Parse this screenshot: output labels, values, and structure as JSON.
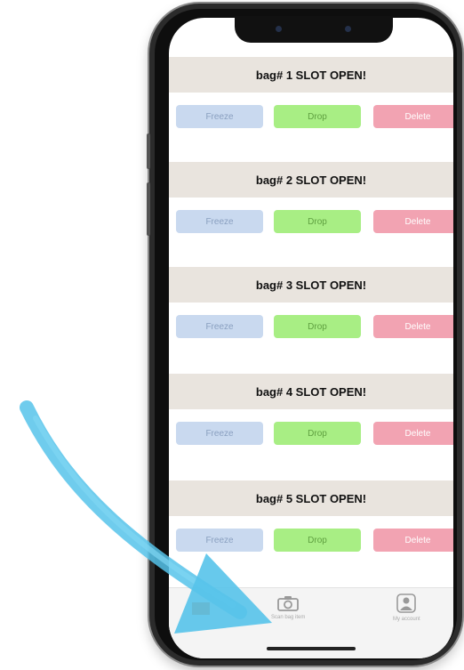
{
  "slots": [
    {
      "title": "bag# 1  SLOT OPEN!",
      "freeze": "Freeze",
      "drop": "Drop",
      "delete": "Delete"
    },
    {
      "title": "bag# 2  SLOT OPEN!",
      "freeze": "Freeze",
      "drop": "Drop",
      "delete": "Delete"
    },
    {
      "title": "bag# 3  SLOT OPEN!",
      "freeze": "Freeze",
      "drop": "Drop",
      "delete": "Delete"
    },
    {
      "title": "bag# 4  SLOT OPEN!",
      "freeze": "Freeze",
      "drop": "Drop",
      "delete": "Delete"
    },
    {
      "title": "bag# 5  SLOT OPEN!",
      "freeze": "Freeze",
      "drop": "Drop",
      "delete": "Delete"
    }
  ],
  "tabbar": {
    "scan_label": "Scan bag item",
    "account_label": "My account"
  },
  "colors": {
    "header_bg": "#e9e4de",
    "freeze": "#c9d9ef",
    "drop": "#a8ee84",
    "delete": "#f2a3b2",
    "arrow": "#56c3ea",
    "tab_accent": "#e8631c"
  }
}
